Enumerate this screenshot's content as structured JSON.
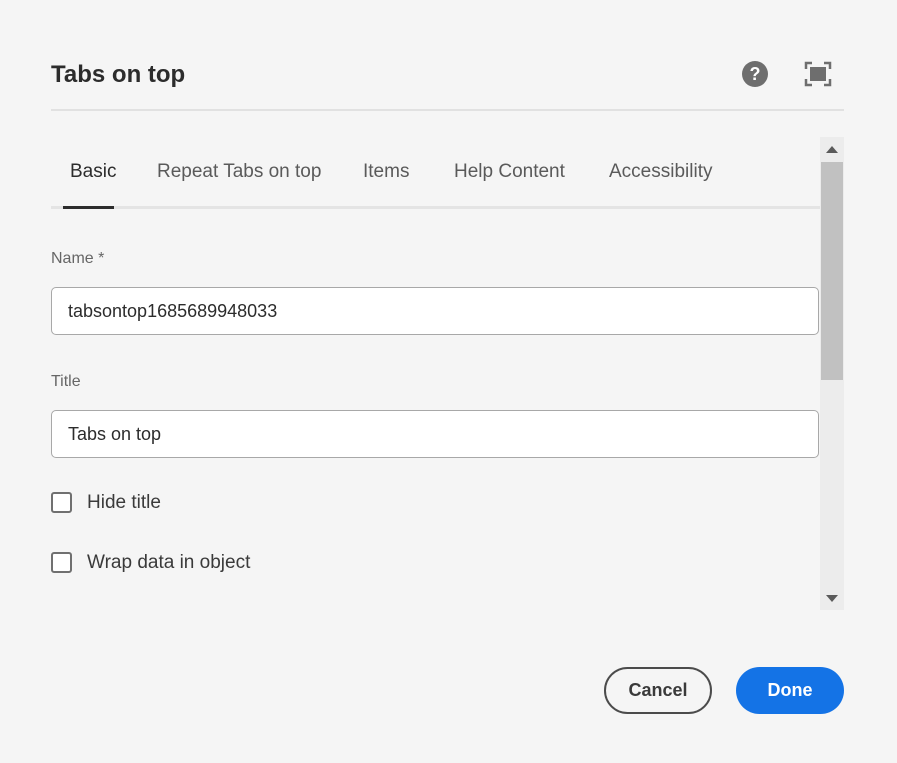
{
  "header": {
    "title": "Tabs on top",
    "help_icon": "help-circle-icon",
    "help_glyph": "?",
    "fullscreen_icon": "fullscreen-icon"
  },
  "tabs": [
    {
      "label": "Basic",
      "active": true
    },
    {
      "label": "Repeat Tabs on top",
      "active": false
    },
    {
      "label": "Items",
      "active": false
    },
    {
      "label": "Help Content",
      "active": false
    },
    {
      "label": "Accessibility",
      "active": false
    }
  ],
  "form": {
    "name": {
      "label": "Name *",
      "value": "tabsontop1685689948033"
    },
    "title": {
      "label": "Title",
      "value": "Tabs on top"
    },
    "hide_title": {
      "label": "Hide title",
      "checked": false
    },
    "wrap_data": {
      "label": "Wrap data in object",
      "checked": false
    }
  },
  "footer": {
    "cancel_label": "Cancel",
    "done_label": "Done"
  },
  "colors": {
    "background": "#f5f5f5",
    "primary": "#1473e6",
    "text": "#2c2c2c",
    "icon": "#6e6e6e"
  }
}
